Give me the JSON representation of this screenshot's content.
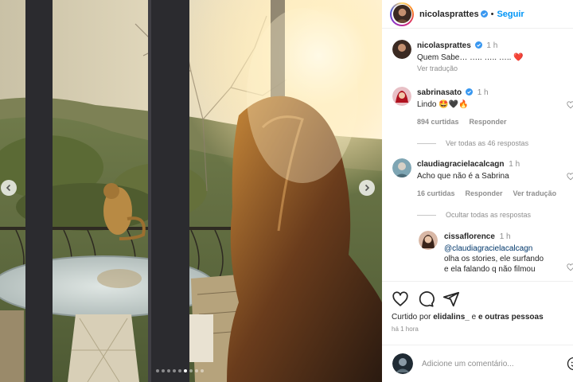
{
  "post": {
    "username": "nicolasprattes",
    "separator": "•",
    "follow_label": "Seguir",
    "carousel": {
      "slide_count": 9,
      "active_index": 5
    }
  },
  "comments": [
    {
      "username": "nicolasprattes",
      "time": "1 h",
      "text": "Quem Sabe… ….. ….. …..",
      "emoji": "❤️",
      "translate_label": "Ver tradução"
    },
    {
      "username": "sabrinasato",
      "time": "1 h",
      "text": "Lindo 🤩🖤🔥",
      "likes": "894 curtidas",
      "reply_label": "Responder",
      "view_replies_label": "Ver todas as 46 respostas"
    },
    {
      "username": "claudiagracielacalcagn",
      "time": "1 h",
      "text": "Acho que não é a Sabrina",
      "likes": "16 curtidas",
      "reply_label": "Responder",
      "translate_label": "Ver tradução",
      "hide_replies_label": "Ocultar todas as respostas"
    },
    {
      "username": "cissaflorence",
      "time": "1 h",
      "mention": "@claudiagracielacalcagn",
      "line2": "olha os stories, ele surfando",
      "line3": "e ela falando q não filmou"
    }
  ],
  "actions": {
    "liked_by_prefix": "Curtido por",
    "liked_by_user": "elidalins_",
    "liked_by_suffix": "e outras pessoas",
    "time_ago": "há 1 hora"
  },
  "composer": {
    "placeholder": "Adicione um comentário..."
  },
  "icons": {
    "heart": "heart-icon",
    "comment": "comment-icon",
    "share": "share-icon",
    "verified": "verified-badge-icon",
    "emoji": "emoji-icon",
    "prev": "chevron-left-icon",
    "next": "chevron-right-icon"
  },
  "colors": {
    "link_blue": "#0095f6",
    "verified_blue": "#3897f0",
    "muted": "#8e8e8e",
    "text": "#262626"
  }
}
